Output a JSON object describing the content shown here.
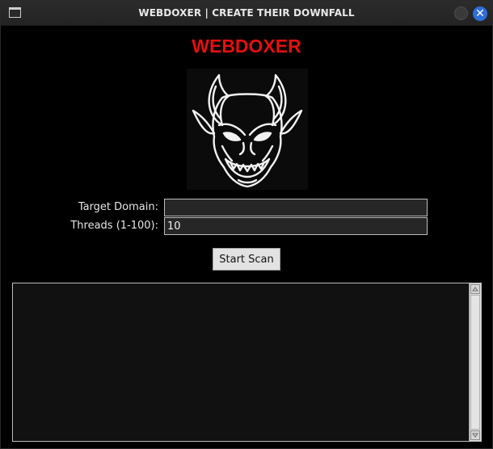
{
  "window": {
    "title": "WEBDOXER | CREATE THEIR DOWNFALL",
    "close_glyph": "✕"
  },
  "app": {
    "title": "WEBDOXER",
    "title_color": "#e31010",
    "logo_icon": "devil-head-icon"
  },
  "form": {
    "target_domain": {
      "label": "Target Domain:",
      "value": ""
    },
    "threads": {
      "label": "Threads (1-100):",
      "value": "10"
    },
    "start_button_label": "Start Scan"
  },
  "output": {
    "text": ""
  }
}
